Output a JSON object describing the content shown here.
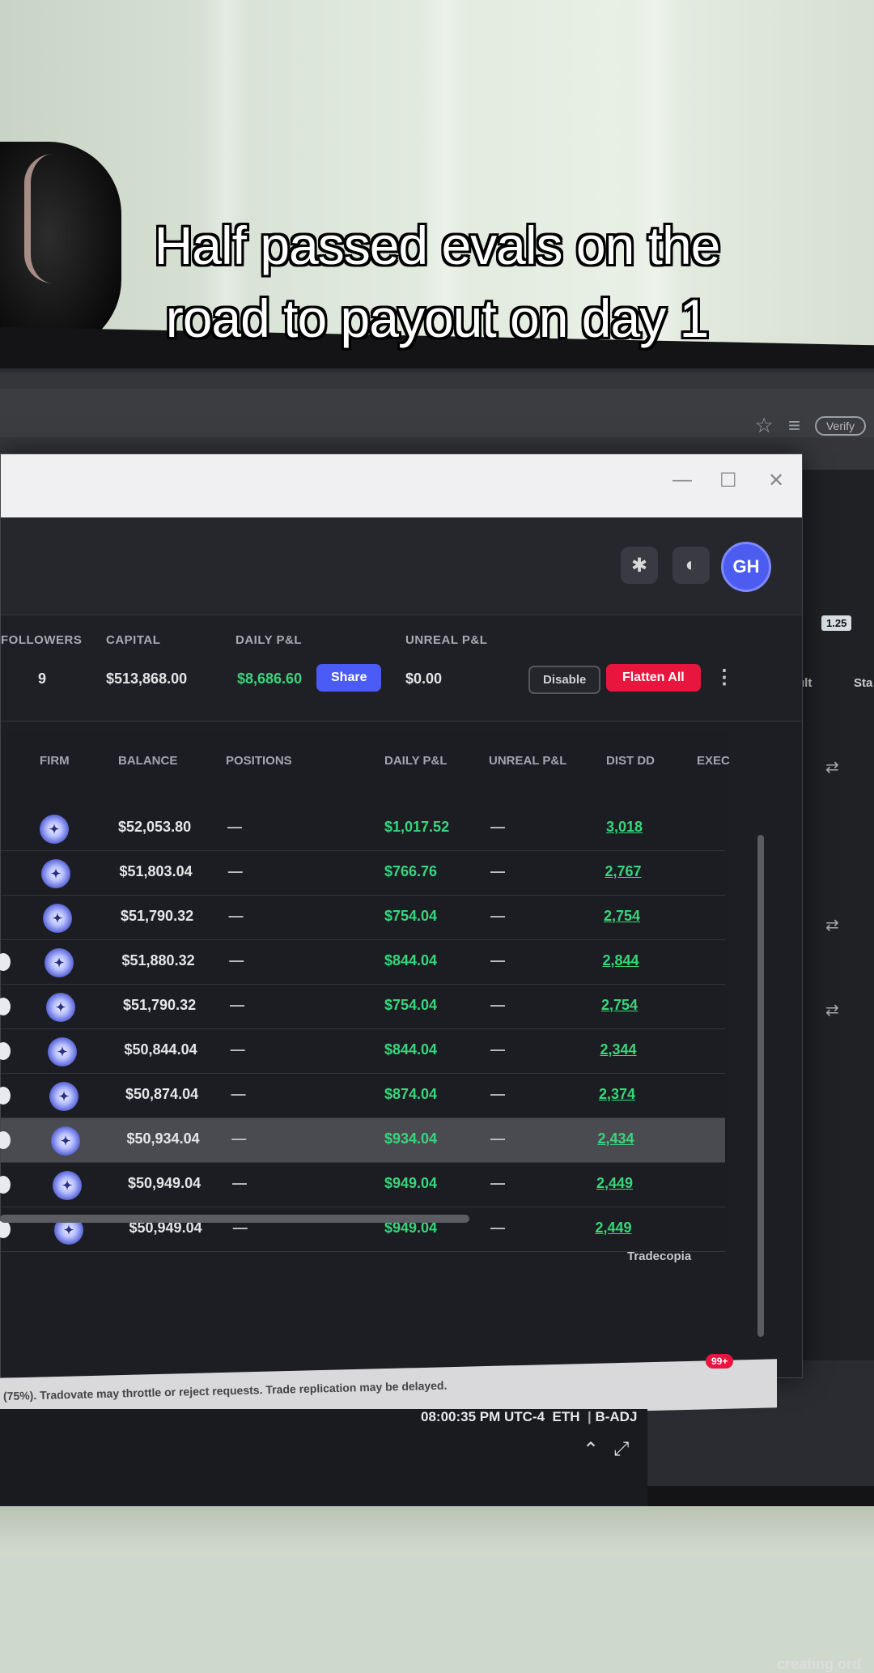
{
  "caption": {
    "line1": "Half passed evals on the",
    "line2": "road to payout on day 1"
  },
  "browser": {
    "verify_label": "Verify"
  },
  "window": {
    "minimize": "—",
    "maximize": "☐",
    "close": "✕"
  },
  "header": {
    "avatar_initials": "GH",
    "settings_icon": "gear-icon",
    "theme_icon": "moon-icon"
  },
  "summary": {
    "followers_label": "FOLLOWERS",
    "followers_value": "9",
    "capital_label": "CAPITAL",
    "capital_value": "$513,868.00",
    "daily_pnl_label": "DAILY P&L",
    "daily_pnl_value": "$8,686.60",
    "share_label": "Share",
    "unreal_pnl_label": "UNREAL P&L",
    "unreal_pnl_value": "$0.00",
    "disable_label": "Disable",
    "flatten_label": "Flatten All",
    "kebab": "⋮"
  },
  "table": {
    "headers": {
      "firm": "FIRM",
      "balance": "BALANCE",
      "positions": "POSITIONS",
      "daily_pnl": "DAILY P&L",
      "unreal_pnl": "UNREAL P&L",
      "dist_dd": "DIST DD",
      "exec": "EXEC"
    },
    "rows": [
      {
        "balance": "$52,053.80",
        "positions": "—",
        "daily_pnl": "$1,017.52",
        "unreal": "—",
        "dist": "3,018"
      },
      {
        "balance": "$51,803.04",
        "positions": "—",
        "daily_pnl": "$766.76",
        "unreal": "—",
        "dist": "2,767"
      },
      {
        "balance": "$51,790.32",
        "positions": "—",
        "daily_pnl": "$754.04",
        "unreal": "—",
        "dist": "2,754"
      },
      {
        "balance": "$51,880.32",
        "positions": "—",
        "daily_pnl": "$844.04",
        "unreal": "—",
        "dist": "2,844"
      },
      {
        "balance": "$51,790.32",
        "positions": "—",
        "daily_pnl": "$754.04",
        "unreal": "—",
        "dist": "2,754"
      },
      {
        "balance": "$50,844.04",
        "positions": "—",
        "daily_pnl": "$844.04",
        "unreal": "—",
        "dist": "2,344"
      },
      {
        "balance": "$50,874.04",
        "positions": "—",
        "daily_pnl": "$874.04",
        "unreal": "—",
        "dist": "2,374"
      },
      {
        "balance": "$50,934.04",
        "positions": "—",
        "daily_pnl": "$934.04",
        "unreal": "—",
        "dist": "2,434"
      },
      {
        "balance": "$50,949.04",
        "positions": "—",
        "daily_pnl": "$949.04",
        "unreal": "—",
        "dist": "2,449"
      },
      {
        "balance": "$50,949.04",
        "positions": "—",
        "daily_pnl": "$949.04",
        "unreal": "—",
        "dist": "2,449"
      }
    ]
  },
  "brand": "Tradecopia",
  "status": {
    "warning": "(75%). Tradovate may throttle or reject requests. Trade replication may be delayed.",
    "badge": "99+",
    "time": "08:00:35 PM UTC-4",
    "session": "ETH",
    "adj": "B-ADJ"
  },
  "right_app": {
    "tag": "1.25",
    "col1": "ult",
    "col2": "Sta",
    "creating": "creating ord"
  },
  "colors": {
    "accent": "#4a5cf5",
    "danger": "#e8163f",
    "positive": "#37d67a"
  }
}
